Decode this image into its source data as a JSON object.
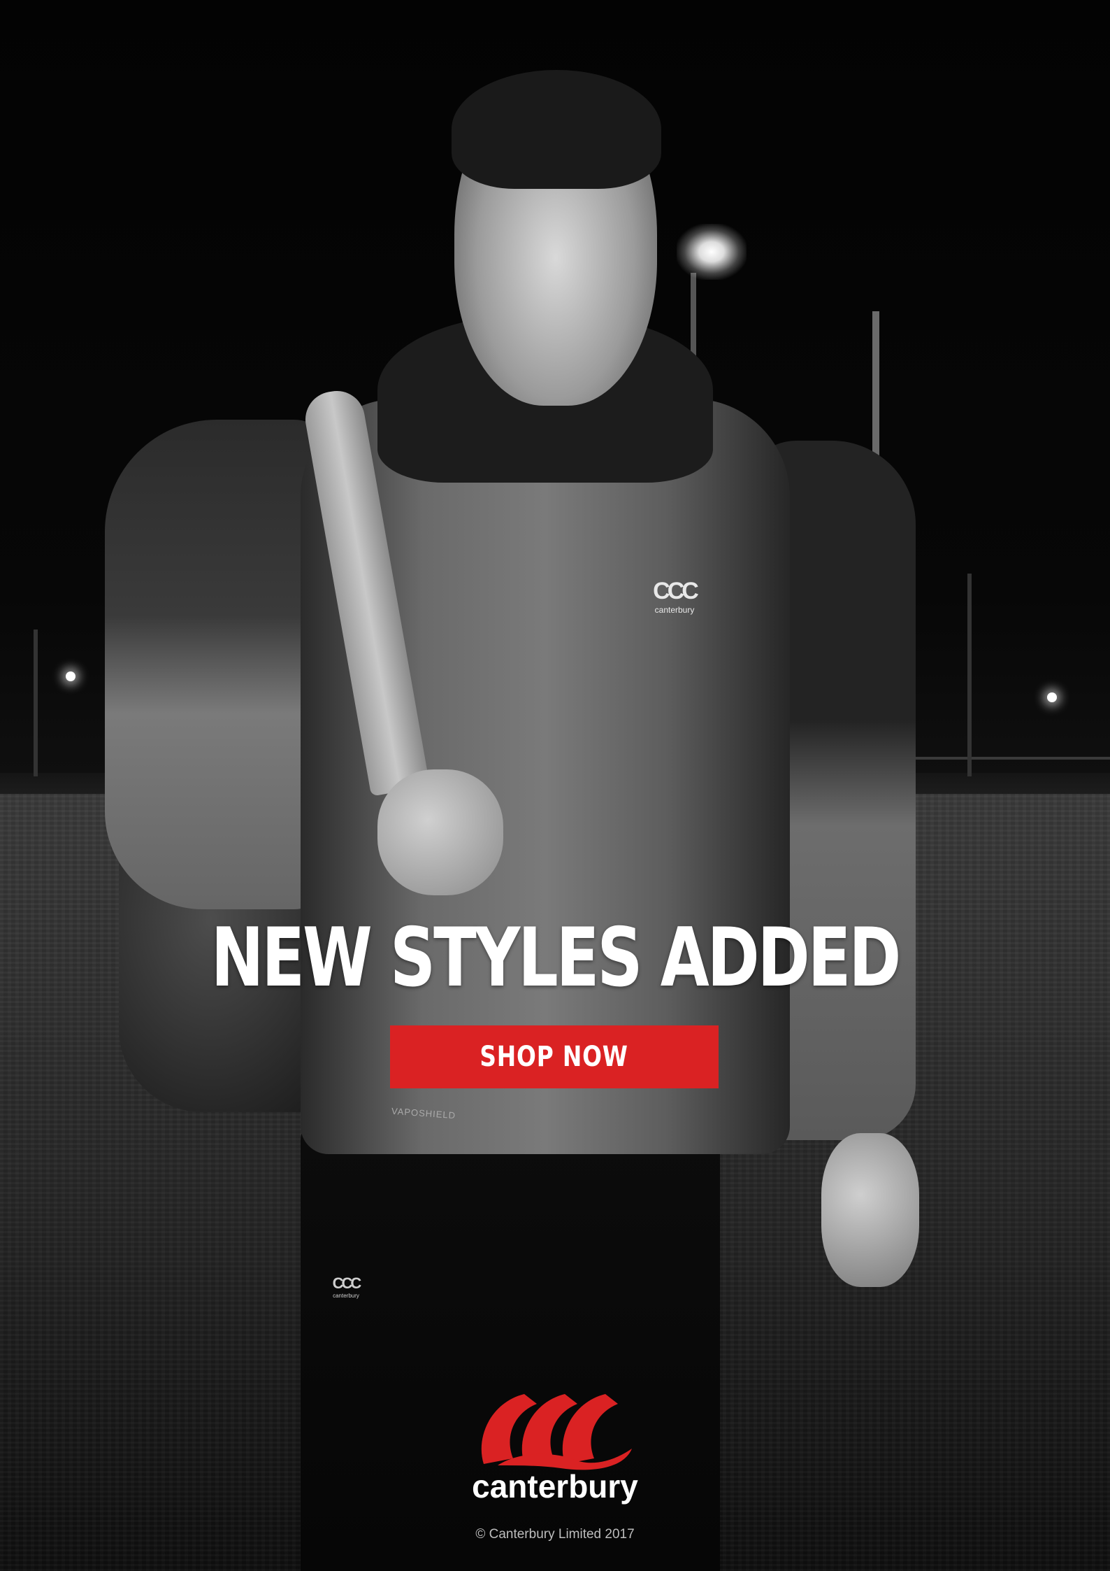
{
  "headline": "NEW STYLES ADDED",
  "cta": {
    "label": "SHOP NOW"
  },
  "brand": {
    "name": "canterbury",
    "logo_icon": "ccc-logo-icon",
    "accent_color": "#da2223"
  },
  "apparel": {
    "chest_logo": "canterbury",
    "pants_logo": "canterbury",
    "tech_label": "VAPOSHIELD"
  },
  "footer": {
    "copyright": "© Canterbury Limited 2017"
  }
}
